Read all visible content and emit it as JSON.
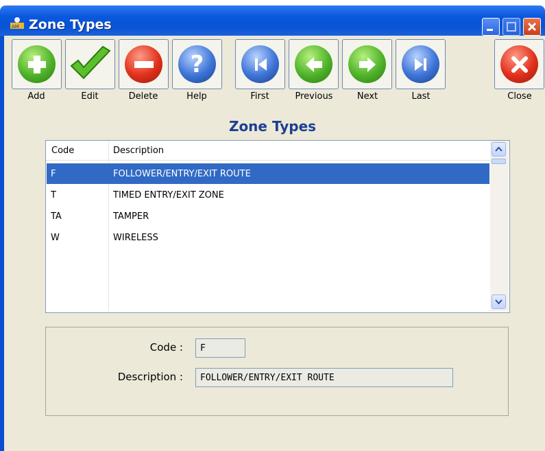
{
  "window": {
    "title": "Zone Types"
  },
  "toolbar": {
    "add": "Add",
    "edit": "Edit",
    "delete": "Delete",
    "help": "Help",
    "first": "First",
    "previous": "Previous",
    "next": "Next",
    "last": "Last",
    "close": "Close"
  },
  "heading": "Zone Types",
  "grid": {
    "columns": [
      "Code",
      "Description"
    ],
    "rows": [
      {
        "code": "F",
        "description": "FOLLOWER/ENTRY/EXIT ROUTE",
        "selected": true
      },
      {
        "code": "T",
        "description": "TIMED ENTRY/EXIT ZONE",
        "selected": false
      },
      {
        "code": "TA",
        "description": "TAMPER",
        "selected": false
      },
      {
        "code": "W",
        "description": "WIRELESS",
        "selected": false
      }
    ]
  },
  "form": {
    "code_label": "Code :",
    "code_value": "F",
    "description_label": "Description :",
    "description_value": "FOLLOWER/ENTRY/EXIT ROUTE"
  },
  "colors": {
    "selection": "#316ac5",
    "heading": "#1c3f94",
    "titlebar": "#0a58dd"
  }
}
